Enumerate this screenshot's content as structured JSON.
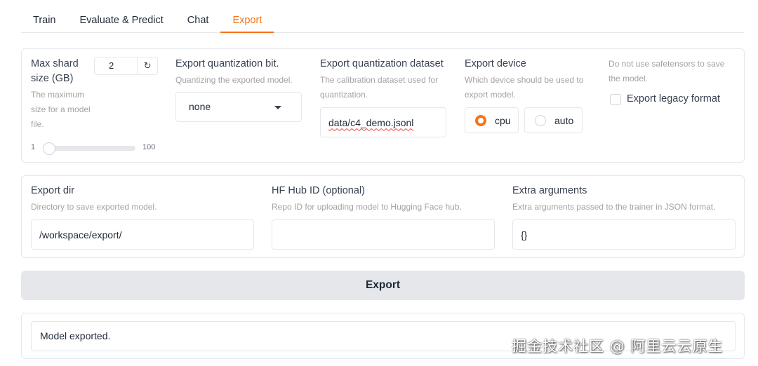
{
  "tabs": [
    "Train",
    "Evaluate & Predict",
    "Chat",
    "Export"
  ],
  "active_tab": "Export",
  "accent_color": "#f97316",
  "max_shard": {
    "label": "Max shard size (GB)",
    "value": "2",
    "reset_icon": "refresh-icon",
    "info": "The maximum size for a model file.",
    "slider_min": "1",
    "slider_max": "100",
    "slider_fraction": 0.01
  },
  "quant_bit": {
    "label": "Export quantization bit.",
    "info": "Quantizing the exported model.",
    "selected": "none"
  },
  "quant_dataset": {
    "label": "Export quantization dataset",
    "info": "The calibration dataset used for quantization.",
    "value": "data/c4_demo.jsonl"
  },
  "device": {
    "label": "Export device",
    "info": "Which device should be used to export model.",
    "options": [
      "cpu",
      "auto"
    ],
    "selected": "cpu"
  },
  "legacy": {
    "info": "Do not use safetensors to save the model.",
    "label": "Export legacy format",
    "checked": false
  },
  "export_dir": {
    "label": "Export dir",
    "info": "Directory to save exported model.",
    "value": "/workspace/export/"
  },
  "hub_id": {
    "label": "HF Hub ID (optional)",
    "info": "Repo ID for uploading model to Hugging Face hub.",
    "value": ""
  },
  "extra_args": {
    "label": "Extra arguments",
    "info": "Extra arguments passed to the trainer in JSON format.",
    "value": "{}"
  },
  "export_button": "Export",
  "output": "Model exported.",
  "watermark": "掘金技术社区 @ 阿里云云原生"
}
